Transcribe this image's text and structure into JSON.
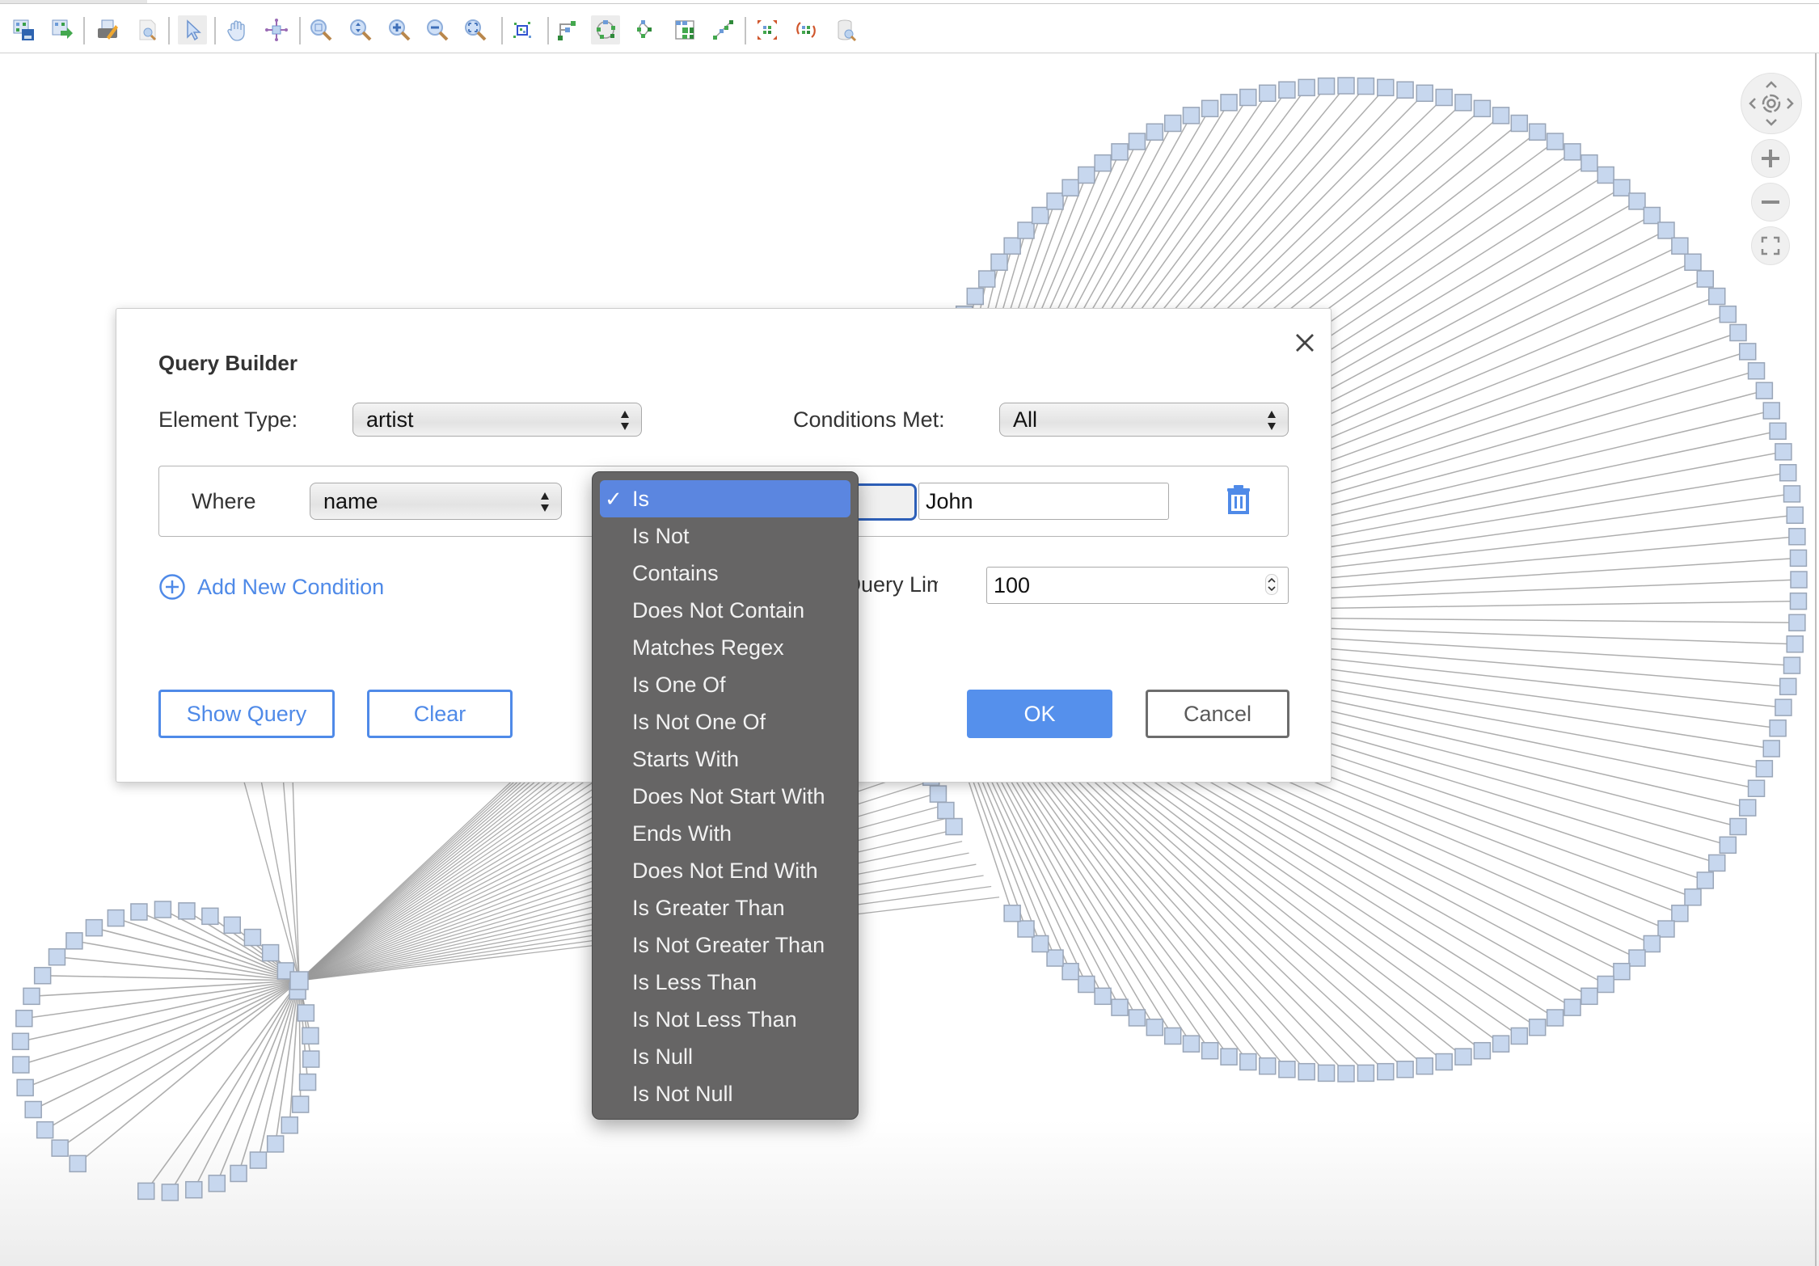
{
  "toolbar": {
    "items": [
      {
        "name": "save-graph-icon",
        "tooltip": ""
      },
      {
        "name": "export-graph-icon",
        "tooltip": ""
      },
      {
        "name": "print-icon",
        "tooltip": ""
      },
      {
        "name": "print-preview-icon",
        "tooltip": ""
      },
      {
        "name": "select-pointer-icon",
        "active": true
      },
      {
        "name": "pan-hand-icon"
      },
      {
        "name": "move-icon"
      },
      {
        "name": "zoom-area-icon"
      },
      {
        "name": "zoom-fit-height-icon"
      },
      {
        "name": "zoom-in-icon"
      },
      {
        "name": "zoom-out-icon"
      },
      {
        "name": "zoom-fit-icon"
      },
      {
        "name": "select-region-icon"
      },
      {
        "name": "hierarchical-layout-icon"
      },
      {
        "name": "circular-layout-icon",
        "active": true
      },
      {
        "name": "organic-layout-icon"
      },
      {
        "name": "grid-layout-icon"
      },
      {
        "name": "orthogonal-layout-icon"
      },
      {
        "name": "expand-icon"
      },
      {
        "name": "rotate-icon"
      },
      {
        "name": "query-database-icon"
      }
    ]
  },
  "dialog": {
    "title": "Query Builder",
    "element_type_label": "Element Type:",
    "element_type_value": "artist",
    "conditions_met_label": "Conditions Met:",
    "conditions_met_value": "All",
    "condition": {
      "where_label": "Where",
      "field_value": "name",
      "operator_value": "Is",
      "value": "John"
    },
    "add_condition_label": "Add New Condition",
    "query_limit_label": "Query Limit:",
    "query_limit_visible": "ry Limit:",
    "query_limit_value": "100",
    "show_query_label": "Show Query",
    "clear_label": "Clear",
    "ok_label": "OK",
    "cancel_label": "Cancel"
  },
  "operator_dropdown": {
    "selected": "Is",
    "options": [
      "Is",
      "Is Not",
      "Contains",
      "Does Not Contain",
      "Matches Regex",
      "Is One Of",
      "Is Not One Of",
      "Starts With",
      "Does Not Start With",
      "Ends With",
      "Does Not End With",
      "Is Greater Than",
      "Is Not Greater Than",
      "Is Less Than",
      "Is Not Less Than",
      "Is Null",
      "Is Not Null"
    ]
  },
  "graph": {
    "node_fill": "#c7d7ee",
    "node_stroke": "#9aa6b8",
    "edge_color": "#9a9a9a",
    "small_cluster_nodes": 36,
    "large_cluster_nodes": 120
  },
  "colors": {
    "accent": "#4f8ae8",
    "primary_button": "#5590ec",
    "dropdown_bg": "#666565",
    "dropdown_selected": "#5b86e0"
  }
}
